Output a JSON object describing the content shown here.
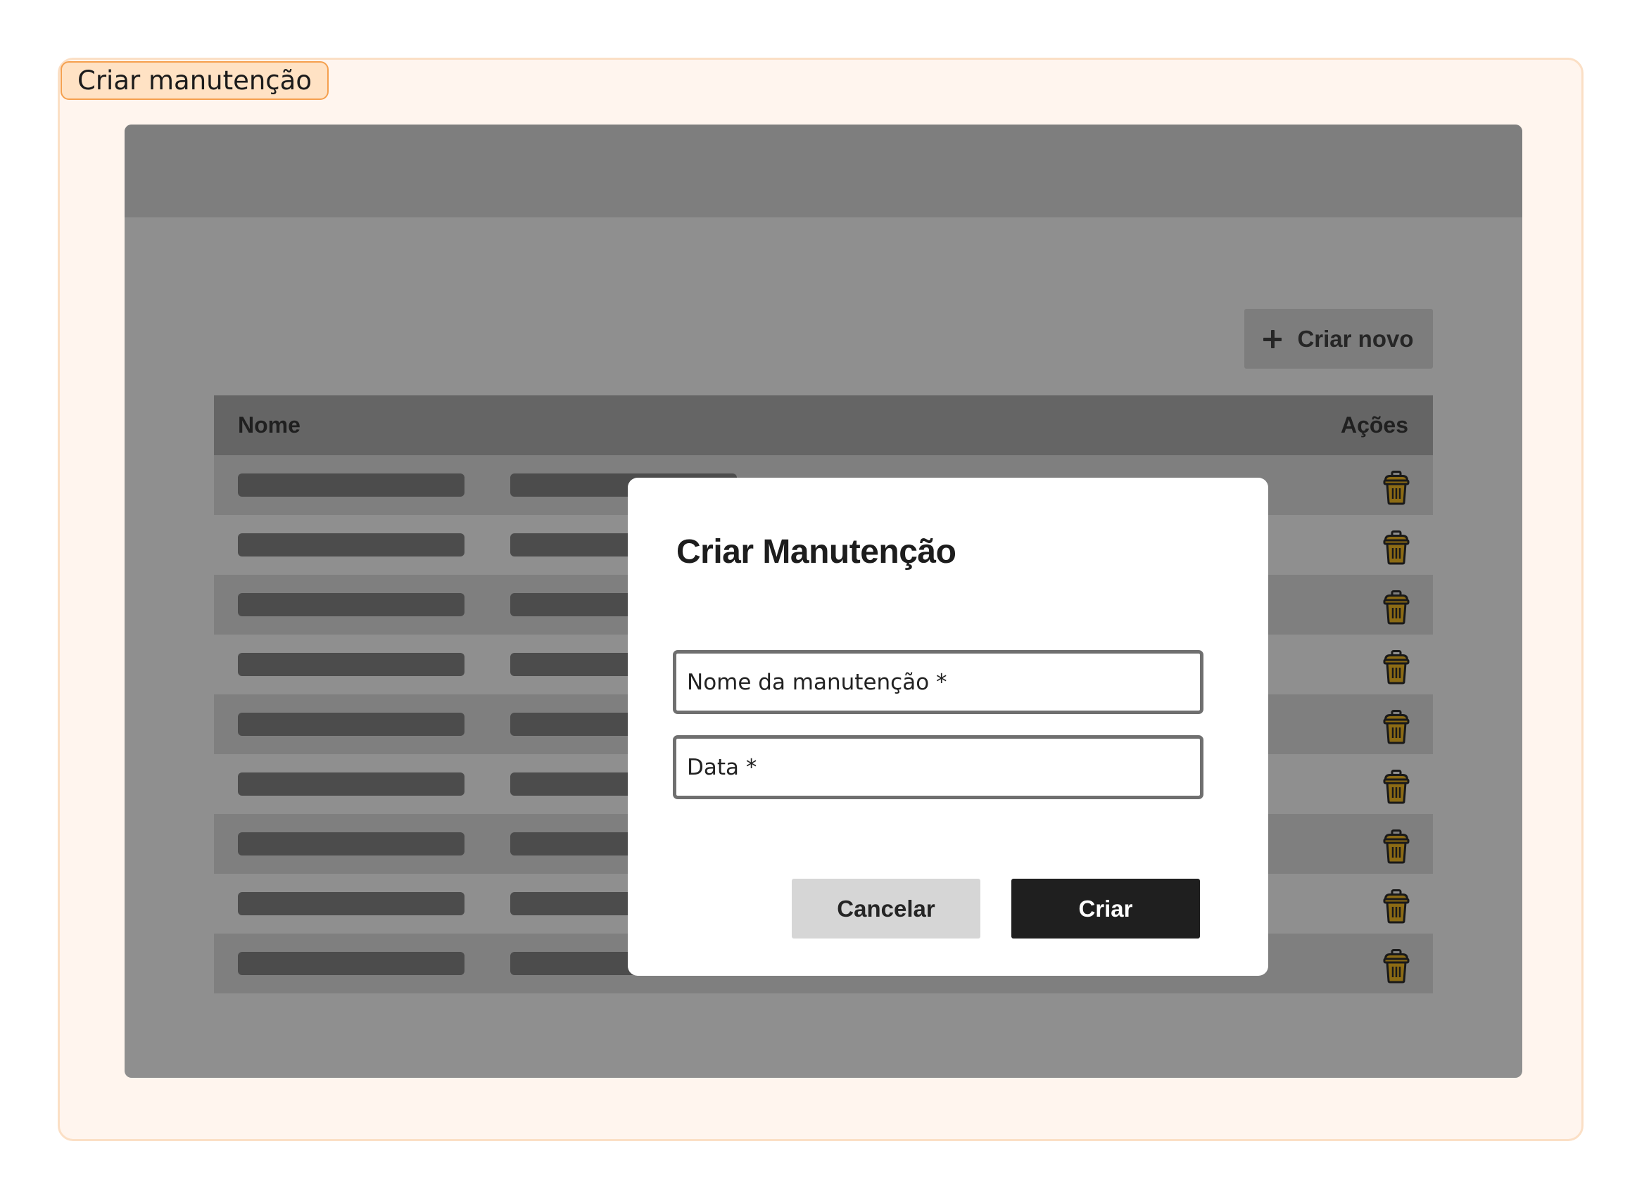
{
  "frame": {
    "label": "Criar manutenção"
  },
  "toolbar": {
    "create_new_label": "Criar novo"
  },
  "table": {
    "headers": {
      "name": "Nome",
      "actions": "Ações"
    },
    "row_count": 9
  },
  "modal": {
    "title": "Criar Manutenção",
    "fields": {
      "name_placeholder": "Nome da manutenção *",
      "date_placeholder": "Data *"
    },
    "cancel_label": "Cancelar",
    "create_label": "Criar"
  },
  "colors": {
    "trash_icon_fill": "#8c6b14",
    "primary_button": "#1f1f1f",
    "frame_accent": "#f5a04e"
  },
  "icons": [
    "plus-icon",
    "trash-icon"
  ]
}
